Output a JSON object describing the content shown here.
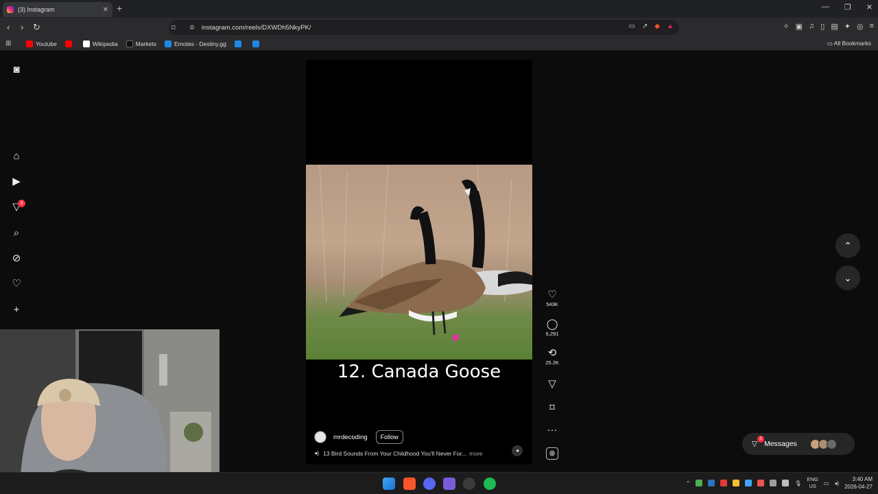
{
  "browser": {
    "tab_title": "(3) Instagram",
    "tab_close": "✕",
    "new_tab": "+",
    "url": "instagram.com/reels/DXWDh5NkyPK/",
    "back": "‹",
    "forward": "›",
    "reload": "↻",
    "window_controls": [
      "—",
      "❐",
      "✕"
    ],
    "bookmarks": [
      {
        "label": "Youtube",
        "color": "#ff0000"
      },
      {
        "label": "",
        "color": "#ff0000"
      },
      {
        "label": "Wikipedia",
        "color": "#ffffff"
      },
      {
        "label": "Markets",
        "color": "#222222"
      },
      {
        "label": "Emotes - Destiny.gg",
        "color": "#1e88e5"
      },
      {
        "label": "",
        "color": "#1e88e5"
      },
      {
        "label": "",
        "color": "#1e88e5"
      }
    ],
    "all_bookmarks": "All Bookmarks"
  },
  "sidebar": {
    "notifications_count": "3"
  },
  "reel": {
    "title_text": "12. Canada Goose",
    "username": "mrdecoding",
    "follow_label": "Follow",
    "description": "13 Bird Sounds From Your Childhood You'll Never For...",
    "more_label": "more",
    "likes": "543K",
    "comments": "6,291",
    "reposts": "25.2K"
  },
  "messages": {
    "label": "Messages",
    "badge": "3"
  },
  "taskbar": {
    "lang_top": "ENG",
    "lang_bottom": "US",
    "time": "3:40 AM",
    "date": "2026-04-27"
  },
  "colors": {
    "accent_red": "#ff3040",
    "brave": "#fb542b"
  }
}
